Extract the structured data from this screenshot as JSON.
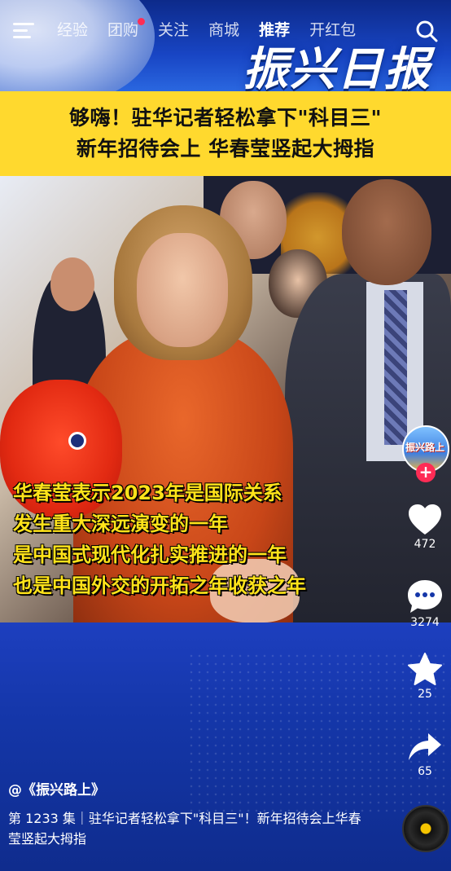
{
  "nav": {
    "tabs": [
      {
        "label": "经验",
        "active": false,
        "dot": false
      },
      {
        "label": "团购",
        "active": false,
        "dot": true
      },
      {
        "label": "关注",
        "active": false,
        "dot": false
      },
      {
        "label": "商城",
        "active": false,
        "dot": false
      },
      {
        "label": "推荐",
        "active": true,
        "dot": false
      },
      {
        "label": "开红包",
        "active": false,
        "dot": false
      }
    ]
  },
  "brand": {
    "logo_text": "振兴日报"
  },
  "banner": {
    "line1": "够嗨！驻华记者轻松拿下\"科目三\"",
    "line2": "新年招待会上 华春莹竖起大拇指"
  },
  "subtitles": [
    "华春莹表示2023年是国际关系",
    "发生重大深远演变的一年",
    "是中国式现代化扎实推进的一年",
    "也是中国外交的开拓之年收获之年"
  ],
  "actions": {
    "avatar_text": "振兴路上",
    "likes": "472",
    "comments": "3274",
    "favorites": "25",
    "shares": "65"
  },
  "info": {
    "author": "@《振兴路上》",
    "description": "第 1233 集｜驻华记者轻松拿下\"科目三\"！新年招待会上华春莹竖起大拇指"
  },
  "colors": {
    "banner_bg": "#ffd92e",
    "subtitle": "#ffe31a",
    "follow_plus": "#fe2c55",
    "page_bg": "#1436a8"
  },
  "icons": [
    "menu-icon",
    "search-icon",
    "heart-icon",
    "comment-icon",
    "star-icon",
    "share-icon",
    "music-disc-icon"
  ]
}
